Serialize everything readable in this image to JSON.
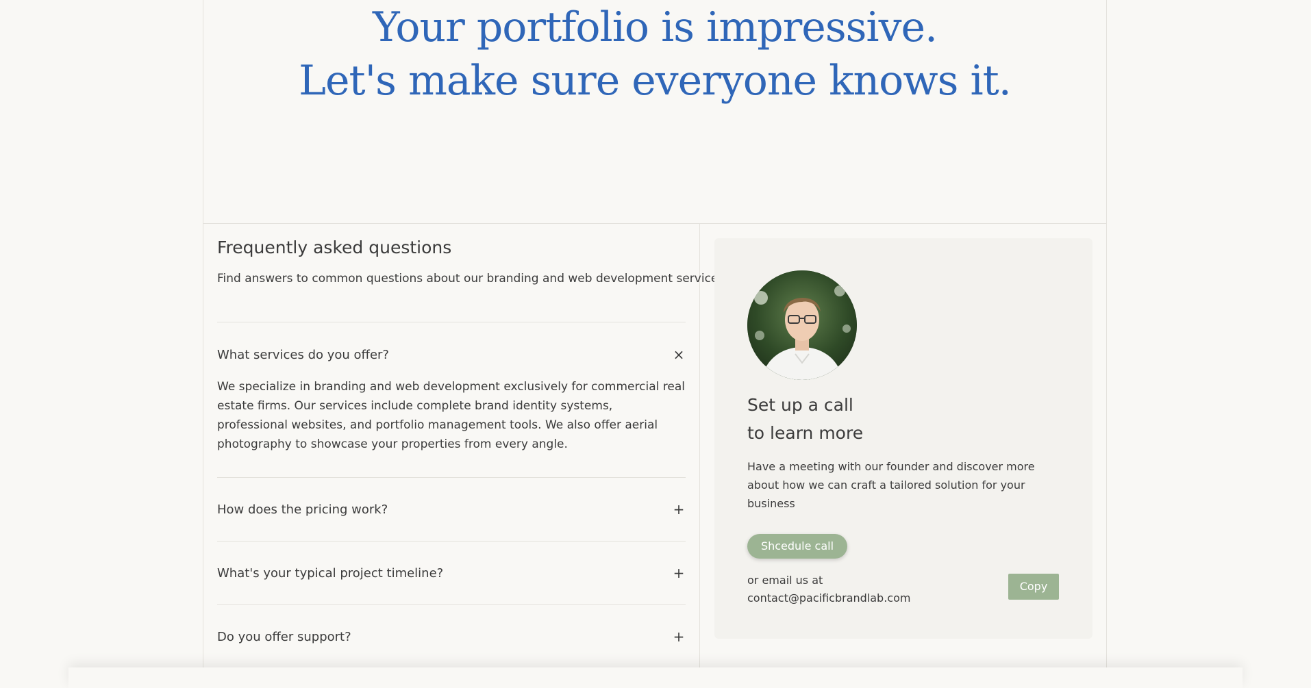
{
  "hero": {
    "line1": "Your portfolio is impressive.",
    "line2": "Let's make sure everyone knows it."
  },
  "faq": {
    "title": "Frequently asked questions",
    "subtitle": "Find answers to common questions about our branding and web development services.",
    "items": [
      {
        "question": "What services do you offer?",
        "answer": "We specialize in branding and web development exclusively for commercial real estate firms. Our services include complete brand identity systems, professional websites, and portfolio management tools. We also offer aerial photography to showcase your properties from every angle.",
        "toggle": "×",
        "open": true
      },
      {
        "question": "How does the pricing work?",
        "toggle": "+",
        "open": false
      },
      {
        "question": "What's your typical project timeline?",
        "toggle": "+",
        "open": false
      },
      {
        "question": "Do you offer support?",
        "toggle": "+",
        "open": false
      }
    ]
  },
  "cta": {
    "avatar_icon": "founder-portrait",
    "title_line1": "Set up a call",
    "title_line2": "to learn more",
    "description": "Have a meeting with our founder and discover more about how we can craft a tailored solution for your business",
    "schedule_label": "Shcedule call",
    "email_label": "or email us at",
    "email": "contact@pacificbrandlab.com",
    "copy_label": "Copy"
  },
  "colors": {
    "background": "#f9f8f5",
    "accent_blue": "#2f66b8",
    "button_green": "#9cb493",
    "card_bg": "#f3f2ee",
    "text": "#3b3b3b"
  }
}
